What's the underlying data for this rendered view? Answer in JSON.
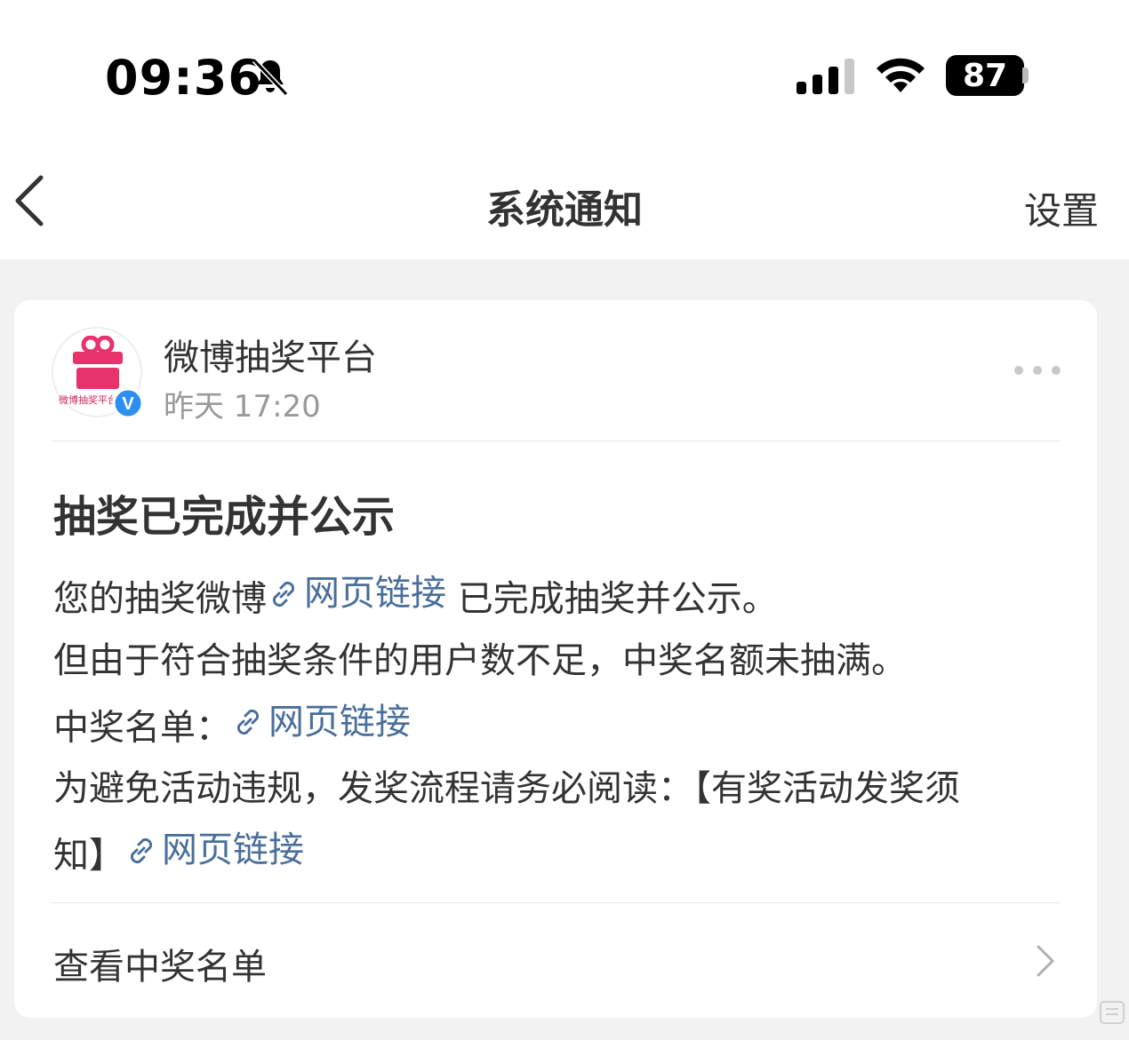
{
  "status_bar": {
    "time": "09:36",
    "battery": "87",
    "icons": [
      "bell-slash-icon",
      "signal-icon",
      "wifi-icon",
      "battery-icon"
    ]
  },
  "nav": {
    "back_icon": "chevron-left-icon",
    "title": "系统通知",
    "settings": "设置"
  },
  "card": {
    "sender": {
      "name": "微博抽奖平台",
      "time": "昨天 17:20",
      "avatar_text": "微博抽奖平台",
      "verified": "V"
    },
    "title": "抽奖已完成并公示",
    "body": {
      "line1_pre": "您的抽奖微博",
      "line1_link": "网页链接",
      "line1_post": " 已完成抽奖并公示。",
      "line2": "但由于符合抽奖条件的用户数不足，中奖名额未抽满。",
      "line3_pre": "中奖名单：",
      "line3_link": "网页链接",
      "line4": "为避免活动违规，发奖流程请务必阅读：【有奖活动发奖须",
      "line5_pre": "知】",
      "line5_link": "网页链接"
    },
    "footer": "查看中奖名单"
  },
  "colors": {
    "link": "#4a6f9b",
    "brand_pink": "#e8326c",
    "verified_blue": "#2c8ff0",
    "background": "#f2f2f2"
  }
}
